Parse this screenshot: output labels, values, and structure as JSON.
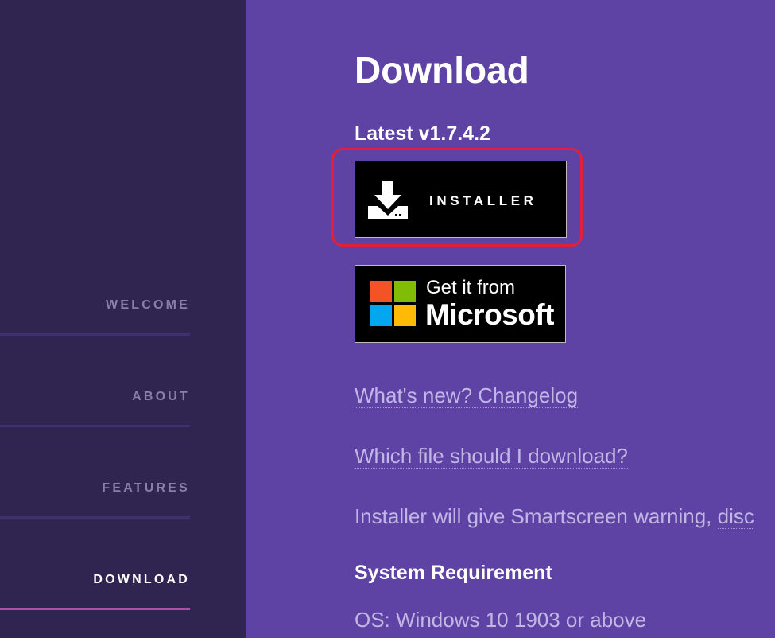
{
  "sidebar": {
    "items": [
      {
        "label": "WELCOME",
        "active": false
      },
      {
        "label": "ABOUT",
        "active": false
      },
      {
        "label": "FEATURES",
        "active": false
      },
      {
        "label": "DOWNLOAD",
        "active": true
      }
    ]
  },
  "main": {
    "title": "Download",
    "latest": "Latest v1.7.4.2",
    "installer_button": {
      "label": "INSTALLER",
      "icon": "download-icon"
    },
    "store_button": {
      "line1": "Get it from",
      "line2": "Microsoft",
      "icon": "microsoft-logo"
    },
    "links": {
      "changelog": "What's new? Changelog",
      "which_file": "Which file should I download?",
      "smartscreen_text": "Installer will give Smartscreen warning, ",
      "smartscreen_link": "disc"
    },
    "requirement_title": "System Requirement",
    "os_requirement": "OS: Windows 10 1903 or above"
  },
  "colors": {
    "background": "#5e43a4",
    "sidebar": "#2f2550",
    "highlight": "#e0213b",
    "ms_red": "#f35325",
    "ms_green": "#81bc06",
    "ms_blue": "#05a6f0",
    "ms_yellow": "#ffba08"
  }
}
